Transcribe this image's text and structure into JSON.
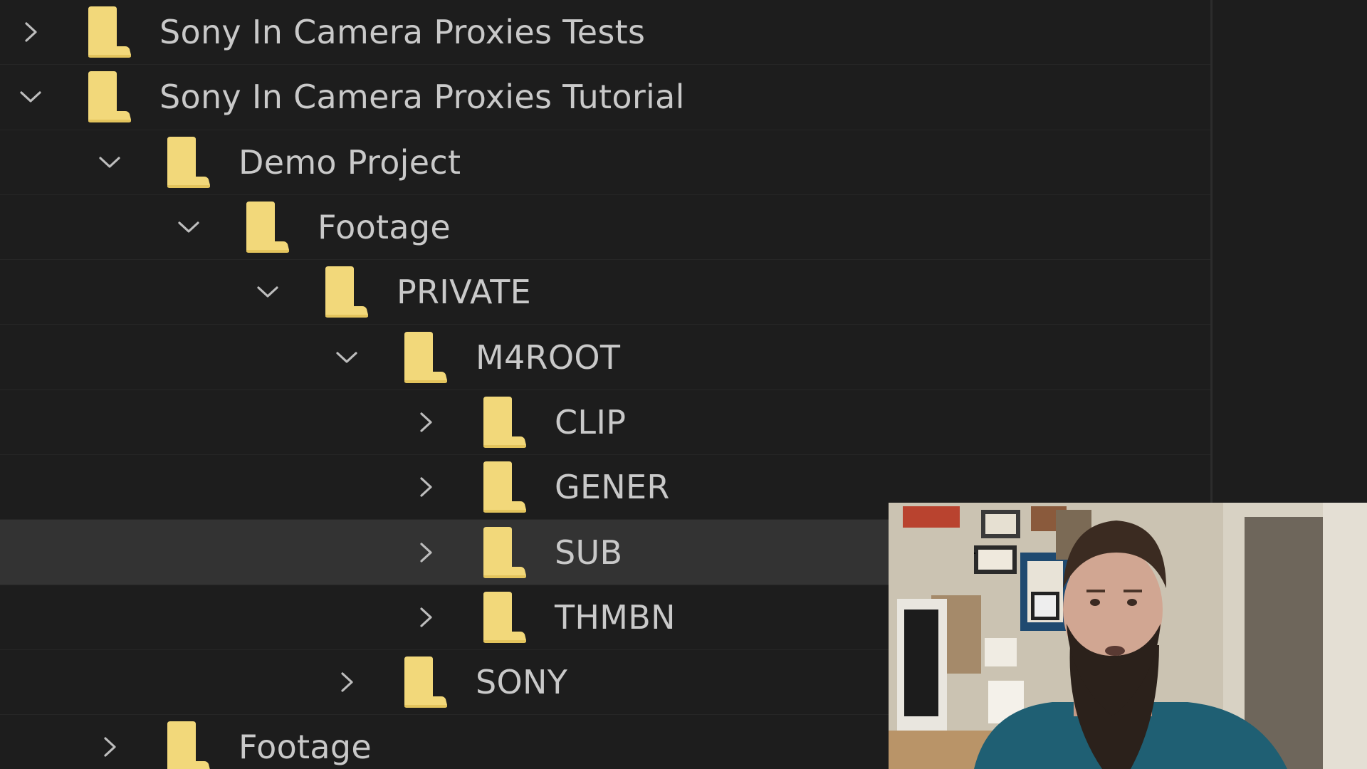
{
  "tree": {
    "rows": [
      {
        "label": "Sony In Camera Proxies Tests",
        "expanded": false,
        "depth": 0,
        "selected": false
      },
      {
        "label": "Sony In Camera Proxies Tutorial",
        "expanded": true,
        "depth": 0,
        "selected": false
      },
      {
        "label": "Demo Project",
        "expanded": true,
        "depth": 1,
        "selected": false
      },
      {
        "label": "Footage",
        "expanded": true,
        "depth": 2,
        "selected": false
      },
      {
        "label": "PRIVATE",
        "expanded": true,
        "depth": 3,
        "selected": false
      },
      {
        "label": "M4ROOT",
        "expanded": true,
        "depth": 4,
        "selected": false
      },
      {
        "label": "CLIP",
        "expanded": false,
        "depth": 5,
        "selected": false
      },
      {
        "label": "GENER",
        "expanded": false,
        "depth": 5,
        "selected": false
      },
      {
        "label": "SUB",
        "expanded": false,
        "depth": 5,
        "selected": true
      },
      {
        "label": "THMBN",
        "expanded": false,
        "depth": 5,
        "selected": false
      },
      {
        "label": "SONY",
        "expanded": false,
        "depth": 4,
        "selected": false
      },
      {
        "label": "Footage",
        "expanded": false,
        "depth": 1,
        "selected": false
      }
    ]
  },
  "icons": {
    "folder": "folder-icon",
    "collapsed": "chevron-right-icon",
    "expanded": "chevron-down-icon"
  },
  "colors": {
    "folder": "#f2d87a",
    "background": "#1d1d1d",
    "selected_row": "#333333",
    "text": "#c9c9c9"
  }
}
